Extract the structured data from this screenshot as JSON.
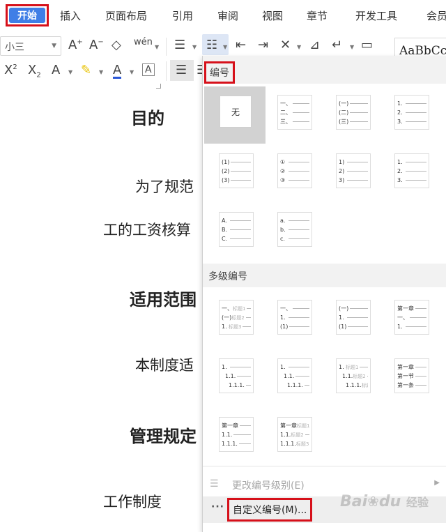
{
  "menu": {
    "tabs": [
      "开始",
      "插入",
      "页面布局",
      "引用",
      "审阅",
      "视图",
      "章节",
      "开发工具",
      "会员"
    ]
  },
  "toolbar": {
    "font_size": "小三",
    "style_preview": "AaBbCc"
  },
  "document": {
    "lines": [
      "目的",
      "为了规范",
      "工的工资核算",
      "适用范围",
      "本制度适",
      "管理规定",
      "工作制度"
    ]
  },
  "panel": {
    "numbering_title": "编号",
    "none_label": "无",
    "multilevel_title": "多级编号",
    "change_level_label": "更改编号级别(E)",
    "custom_label": "自定义编号(M)...",
    "single_level": [
      [
        "一、",
        "二、",
        "三、"
      ],
      [
        "(一)",
        "(二)",
        "(三)"
      ],
      [
        "1.",
        "2.",
        "3."
      ],
      [
        "(1)",
        "(2)",
        "(3)"
      ],
      [
        "①",
        "②",
        "③"
      ],
      [
        "1)",
        "2)",
        "3)"
      ],
      [
        "1.",
        "2.",
        "3."
      ],
      [
        "A.",
        "B.",
        "C."
      ],
      [
        "a.",
        "b.",
        "c."
      ]
    ],
    "multi_level": [
      {
        "markers": [
          "一、",
          "(一)",
          "1."
        ],
        "captions": [
          "标题1",
          "标题2",
          "标题3"
        ]
      },
      {
        "markers": [
          "一、",
          "1.",
          "(1)"
        ],
        "captions": [
          "",
          "",
          ""
        ]
      },
      {
        "markers": [
          "(一)",
          "1.",
          "(1)"
        ],
        "captions": [
          "",
          "",
          ""
        ]
      },
      {
        "markers": [
          "第一章",
          "一、",
          "1."
        ],
        "captions": [
          "",
          "",
          ""
        ]
      },
      {
        "markers": [
          "1.",
          "1.1.",
          "1.1.1."
        ],
        "captions": [
          "",
          "",
          ""
        ]
      },
      {
        "markers": [
          "1.",
          "1.1.",
          "1.1.1."
        ],
        "captions": [
          "",
          "",
          ""
        ]
      },
      {
        "markers": [
          "1.",
          "1.1.",
          "1.1.1."
        ],
        "captions": [
          "标题1",
          "标题2",
          "标题3"
        ]
      },
      {
        "markers": [
          "第一章",
          "第一节",
          "第一条"
        ],
        "captions": [
          "",
          "",
          ""
        ]
      },
      {
        "markers": [
          "第一章",
          "1.1.",
          "1.1.1."
        ],
        "captions": [
          "",
          "",
          ""
        ]
      },
      {
        "markers": [
          "第一章",
          "1.1.",
          "1.1.1."
        ],
        "captions": [
          "标题1",
          "标题2",
          "标题3"
        ]
      }
    ]
  },
  "watermark": {
    "text_latin": "Bai",
    "text_latin2": "du",
    "text_cn": "经验"
  }
}
